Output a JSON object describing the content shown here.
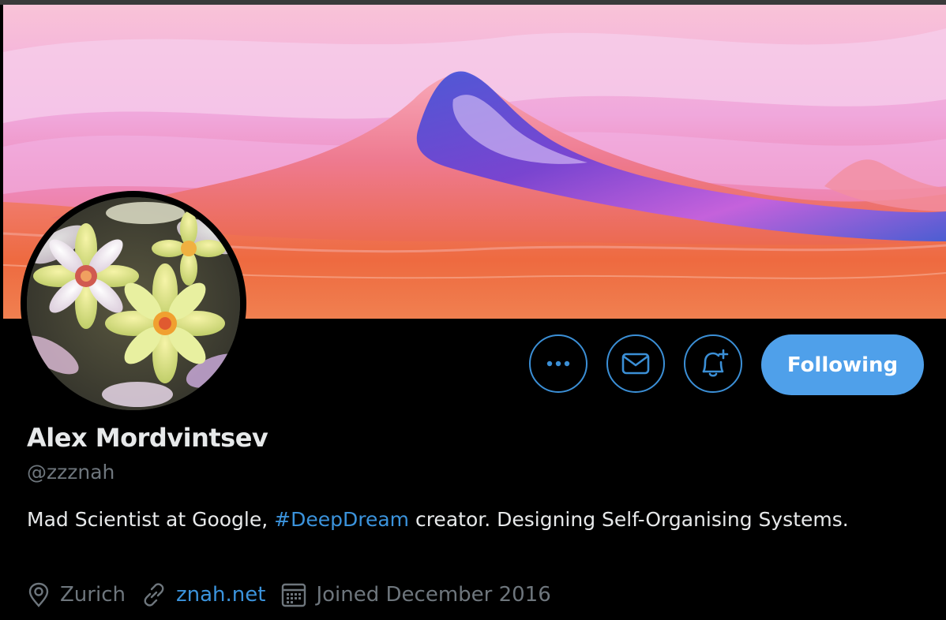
{
  "profile": {
    "name": "Alex Mordvintsev",
    "handle": "@zzznah",
    "bio": {
      "before": "Mad Scientist at Google, ",
      "hashtag": "#DeepDream",
      "after": " creator. Designing Self-Organising Systems."
    },
    "location": "Zurich",
    "website": "znah.net",
    "joined": "Joined December 2016"
  },
  "actions": {
    "more_icon": "more-dots-icon",
    "message_icon": "envelope-icon",
    "notify_icon": "bell-plus-icon",
    "follow_label": "Following"
  },
  "colors": {
    "accent": "#4fa0ea",
    "link": "#3b93dc",
    "background": "#000000",
    "secondary_text": "#6e767d"
  }
}
